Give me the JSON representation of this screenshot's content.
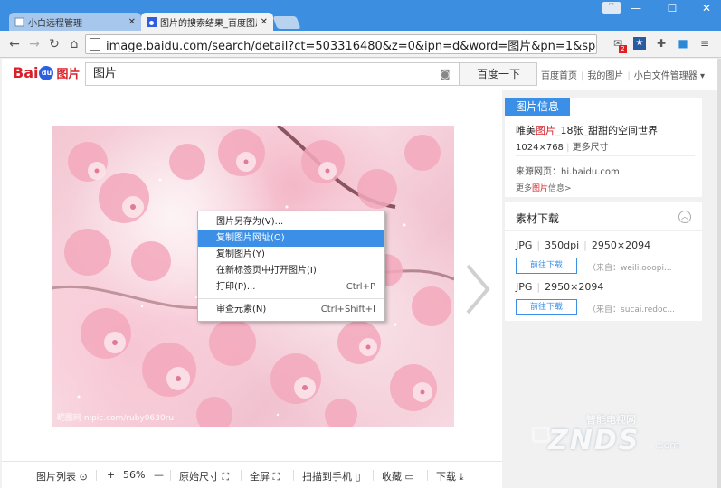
{
  "browser": {
    "tabs": [
      {
        "label": "小白远程管理",
        "active": false
      },
      {
        "label": "图片的搜索结果_百度图片",
        "active": true
      }
    ],
    "url": "image.baidu.com/search/detail?ct=503316480&z=0&ipn=d&word=图片&pn=1&spn=0&d",
    "window_controls": {
      "minimize": "—",
      "maximize": "☐",
      "close": "✕"
    },
    "badge": "2"
  },
  "header": {
    "logo_text": "Bai",
    "logo_paw": "du",
    "logo_suffix": "图片",
    "search_value": "图片",
    "search_button": "百度一下",
    "links": [
      "百度首页",
      "我的图片",
      "小白文件管理器 ▾"
    ]
  },
  "viewer": {
    "watermark": "昵图网 nipic.com/ruby0630ru"
  },
  "context_menu": {
    "items": [
      {
        "label": "图片另存为(V)...",
        "shortcut": "",
        "highlight": false
      },
      {
        "label": "复制图片网址(O)",
        "shortcut": "",
        "highlight": true
      },
      {
        "label": "复制图片(Y)",
        "shortcut": "",
        "highlight": false
      },
      {
        "label": "在新标签页中打开图片(I)",
        "shortcut": "",
        "highlight": false
      },
      {
        "label": "打印(P)...",
        "shortcut": "Ctrl+P",
        "highlight": false
      }
    ],
    "inspect": {
      "label": "审查元素(N)",
      "shortcut": "Ctrl+Shift+I"
    }
  },
  "bottom_bar": {
    "list": "图片列表 ⊙",
    "zoom_in": "+",
    "zoom": "56%",
    "zoom_out": "—",
    "original": "原始尺寸 ⛶",
    "fullscreen": "全屏 ⛶",
    "scan": "扫描到手机 ▯",
    "collect": "收藏 ▭",
    "download": "下载 ⤓"
  },
  "info": {
    "tag": "图片信息",
    "title_prefix": "唯美",
    "title_red": "图片",
    "title_suffix": "_18张_甜甜的空间世界",
    "size": "1024×768",
    "more_sizes": "更多尺寸",
    "source_label": "来源网页：hi.baidu.com",
    "more_prefix": "更多",
    "more_red": "图片",
    "more_suffix": "信息>"
  },
  "material": {
    "title": "素材下载",
    "rows": [
      {
        "format": "JPG",
        "dpi": "350dpi",
        "dims": "2950×2094",
        "button": "前往下载",
        "source": "（来自：weili.ooopi..."
      },
      {
        "format": "JPG",
        "dpi": "",
        "dims": "2950×2094",
        "button": "前往下载",
        "source": "（来自：sucai.redoc..."
      }
    ]
  },
  "znds": {
    "top": "智能电视网",
    "main": "ZNDS",
    "com": ".com"
  },
  "colors": {
    "titlebar": "#3c8fe0",
    "accent": "#3b8fe6",
    "baidu_red": "#d8212a"
  }
}
